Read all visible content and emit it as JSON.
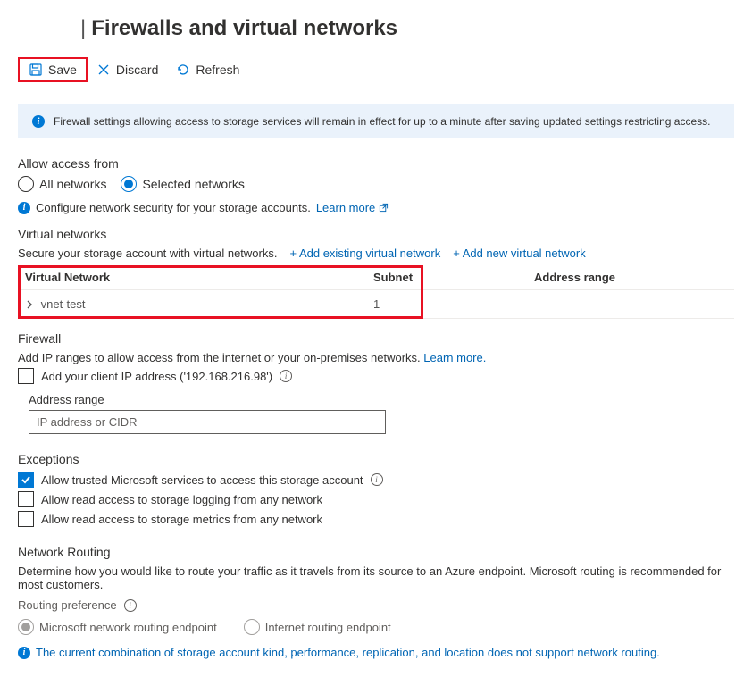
{
  "header": {
    "title": "Firewalls and virtual networks"
  },
  "toolbar": {
    "save": "Save",
    "discard": "Discard",
    "refresh": "Refresh"
  },
  "banner": {
    "text": "Firewall settings allowing access to storage services will remain in effect for up to a minute after saving updated settings restricting access."
  },
  "access": {
    "title": "Allow access from",
    "all": "All networks",
    "selected": "Selected networks",
    "hint": "Configure network security for your storage accounts.",
    "learn_more": "Learn more"
  },
  "vnet": {
    "title": "Virtual networks",
    "desc": "Secure your storage account with virtual networks.",
    "add_existing": "+ Add existing virtual network",
    "add_new": "+ Add new virtual network",
    "cols": {
      "name": "Virtual Network",
      "subnet": "Subnet",
      "range": "Address range"
    },
    "row": {
      "name": "vnet-test",
      "subnet": "1"
    }
  },
  "firewall": {
    "title": "Firewall",
    "desc": "Add IP ranges to allow access from the internet or your on-premises networks.",
    "learn_more": "Learn more.",
    "client_ip_label": "Add your client IP address ('192.168.216.98')",
    "range_label": "Address range",
    "placeholder": "IP address or CIDR"
  },
  "exceptions": {
    "title": "Exceptions",
    "trusted": "Allow trusted Microsoft services to access this storage account",
    "logging": "Allow read access to storage logging from any network",
    "metrics": "Allow read access to storage metrics from any network"
  },
  "routing": {
    "title": "Network Routing",
    "desc": "Determine how you would like to route your traffic as it travels from its source to an Azure endpoint. Microsoft routing is recommended for most customers.",
    "pref_label": "Routing preference",
    "ms": "Microsoft network routing endpoint",
    "internet": "Internet routing endpoint",
    "warn": "The current combination of storage account kind, performance, replication, and location does not support network routing."
  }
}
